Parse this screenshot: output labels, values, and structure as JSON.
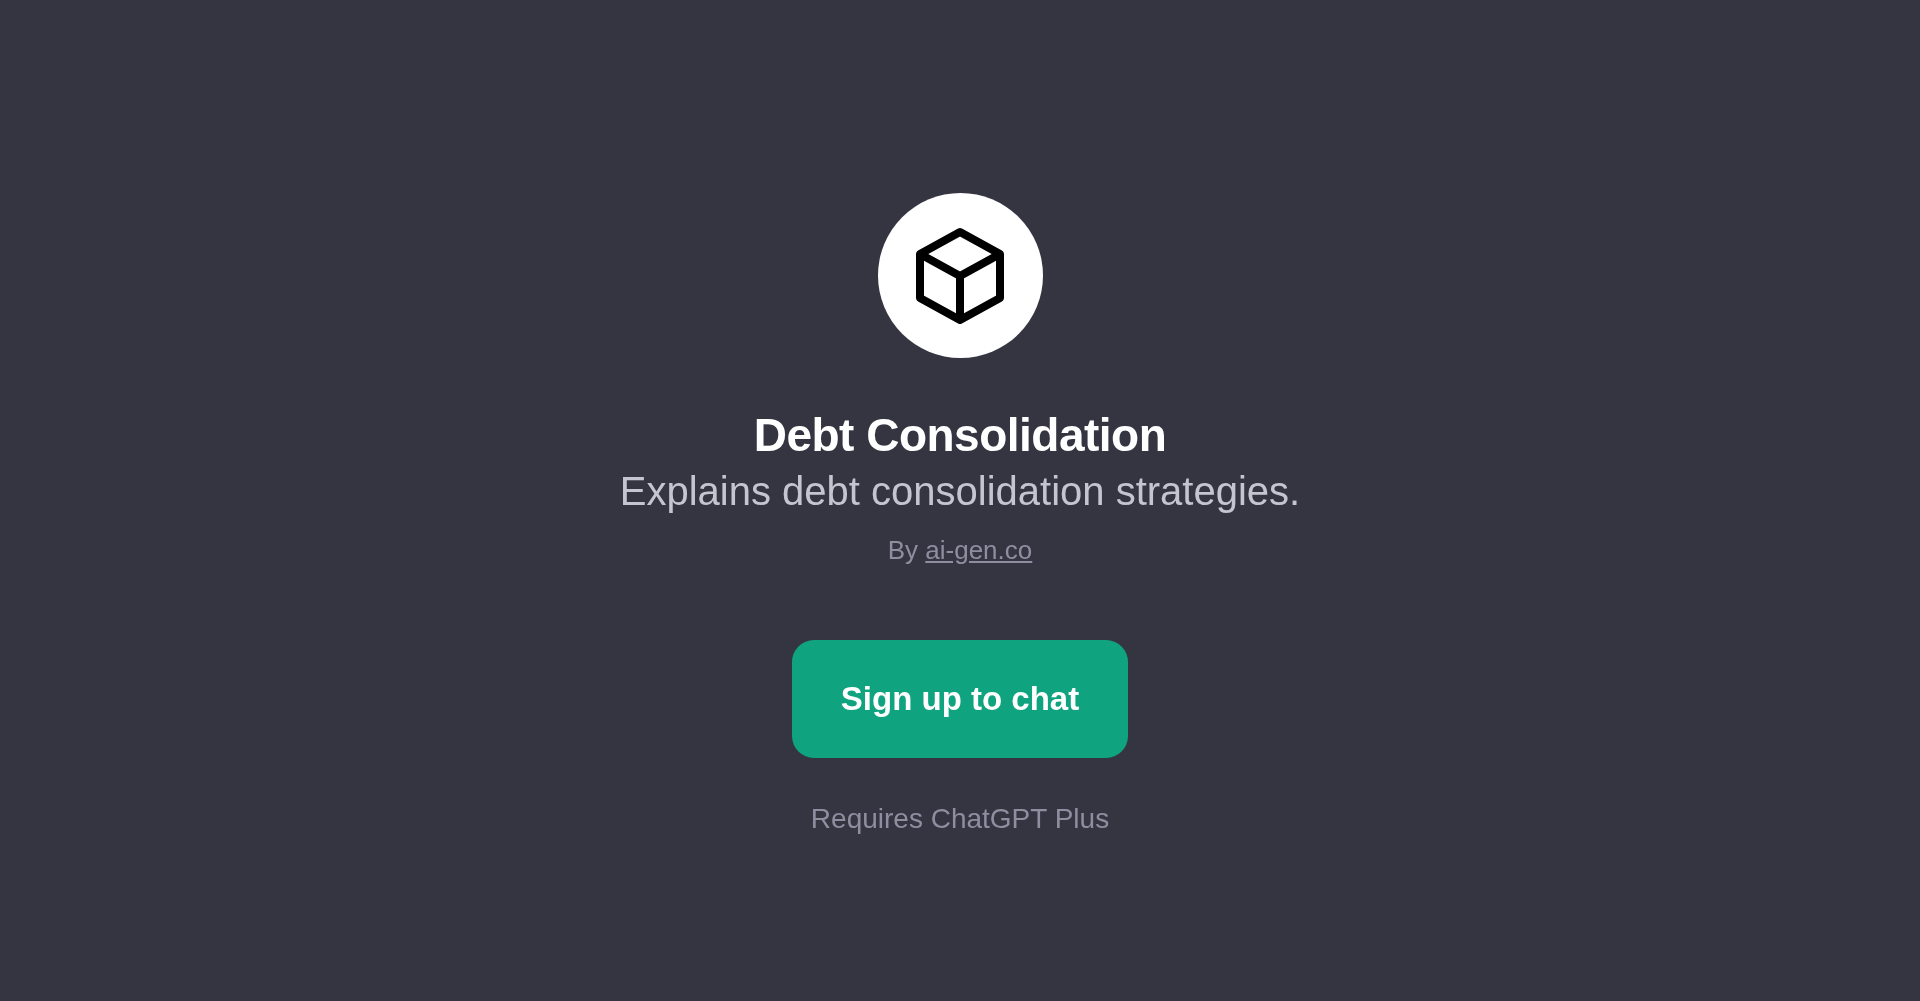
{
  "gpt": {
    "title": "Debt Consolidation",
    "description": "Explains debt consolidation strategies.",
    "author_prefix": "By",
    "author_link": "ai-gen.co"
  },
  "button": {
    "label": "Sign up to chat"
  },
  "note": "Requires ChatGPT Plus"
}
